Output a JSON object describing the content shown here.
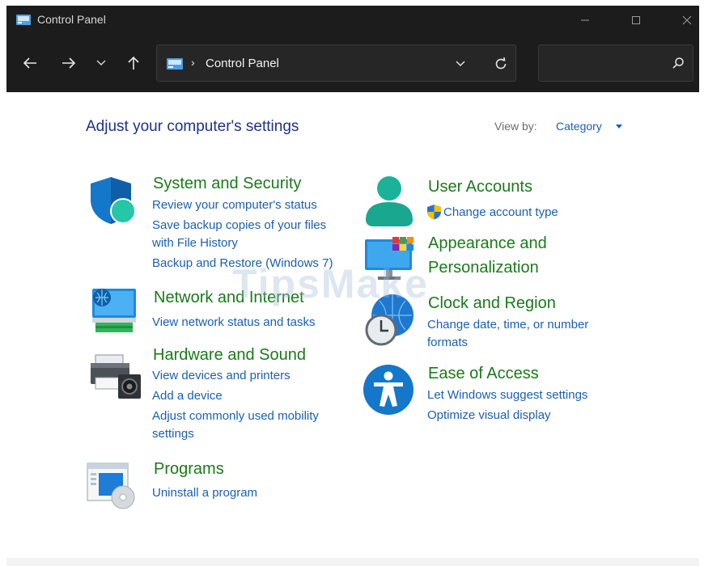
{
  "window": {
    "title": "Control Panel",
    "controls": {
      "minimize_icon": "minimize-icon",
      "maximize_icon": "maximize-icon",
      "close_icon": "close-icon"
    }
  },
  "navigation": {
    "breadcrumb_separator": "›",
    "address": "Control Panel",
    "search_placeholder": "",
    "icons": [
      "back-arrow-icon",
      "forward-arrow-icon",
      "recent-locations-icon",
      "up-arrow-icon",
      "address-dropdown-icon",
      "refresh-icon",
      "search-icon"
    ]
  },
  "content": {
    "heading": "Adjust your computer's settings",
    "view_by_label": "View by:",
    "view_by_value": "Category",
    "watermark": "TipsMake"
  },
  "categories": [
    {
      "title": "System and Security",
      "icon": "shield-icon",
      "links": [
        "Review your computer's status",
        "Save backup copies of your files",
        "with File History",
        "Backup and Restore (Windows 7)"
      ]
    },
    {
      "title": "Network and Internet",
      "icon": "network-monitor-icon",
      "links": [
        "View network status and tasks"
      ]
    },
    {
      "title": "Hardware and Sound",
      "icon": "printer-speaker-icon",
      "links": [
        "View devices and printers",
        "Add a device",
        "Adjust commonly used mobility",
        "settings"
      ]
    },
    {
      "title": "Programs",
      "icon": "programs-disc-icon",
      "links": [
        "Uninstall a program"
      ]
    },
    {
      "title": "User Accounts",
      "icon": "user-icon",
      "links": [
        "Change account type"
      ],
      "link_icon": "uac-shield-icon"
    },
    {
      "title": "Appearance and",
      "title_line2": "Personalization",
      "icon": "appearance-monitor-icon",
      "links": []
    },
    {
      "title": "Clock and Region",
      "icon": "clock-globe-icon",
      "links": [
        "Change date, time, or number",
        "formats"
      ]
    },
    {
      "title": "Ease of Access",
      "icon": "accessibility-icon",
      "links": [
        "Let Windows suggest settings",
        "Optimize visual display"
      ]
    }
  ],
  "colors": {
    "titlebar_bg": "#1c1c1c",
    "heading": "#1e3287",
    "category_title": "#1a7a1a",
    "link": "#1a5fb4"
  }
}
